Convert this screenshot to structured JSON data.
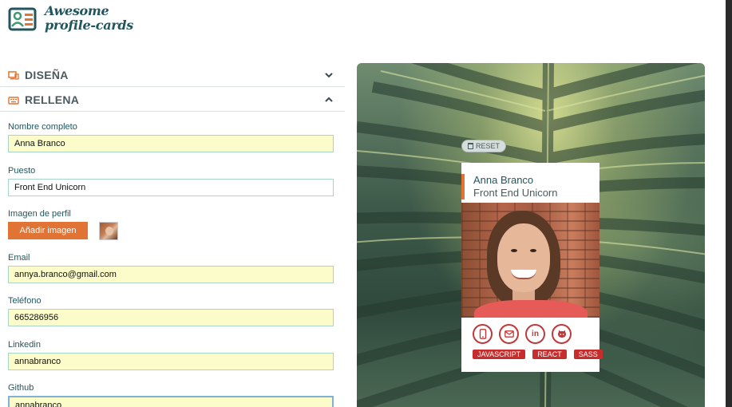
{
  "logo": {
    "line1": "Awesome",
    "line2": "profile-cards"
  },
  "sections": {
    "design": {
      "label": "DISEÑA",
      "icon": "monitor-icon",
      "expanded": false
    },
    "fill": {
      "label": "RELLENA",
      "icon": "keyboard-icon",
      "expanded": true
    }
  },
  "form": {
    "name_label": "Nombre completo",
    "name_value": "Anna Branco",
    "job_label": "Puesto",
    "job_value": "Front End Unicorn",
    "image_label": "Imagen de perfil",
    "image_button": "Añadir imagen",
    "email_label": "Email",
    "email_value": "annya.branco@gmail.com",
    "phone_label": "Teléfono",
    "phone_value": "665286956",
    "linkedin_label": "Linkedin",
    "linkedin_value": "annabranco",
    "github_label": "Github",
    "github_value": "annabranco"
  },
  "preview": {
    "reset_label": "RESET",
    "card_name": "Anna Branco",
    "card_job": "Front End Unicorn",
    "socials": [
      "phone-icon",
      "mail-icon",
      "linkedin-icon",
      "github-icon"
    ],
    "linkedin_glyph": "in",
    "skills": [
      "JAVASCRIPT",
      "REACT",
      "SASS"
    ]
  },
  "colors": {
    "primary": "#22565f",
    "accent": "#e17334",
    "skill": "#c72d2c",
    "input_bg": "#fbfcc9"
  }
}
